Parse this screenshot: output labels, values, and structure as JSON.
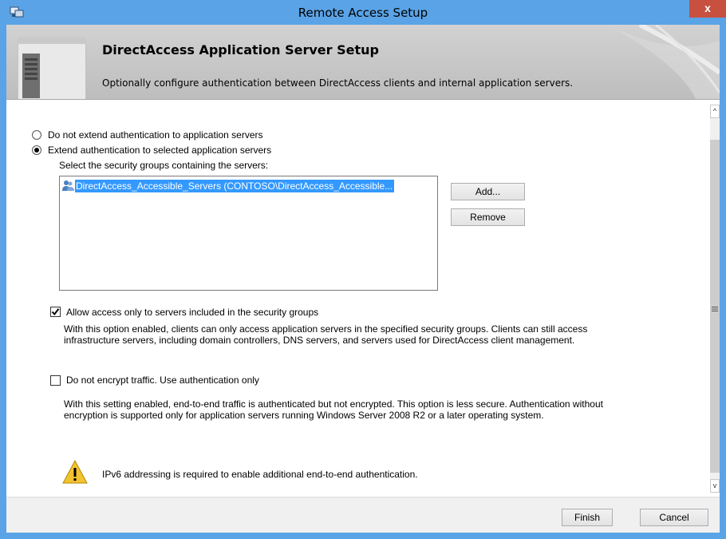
{
  "window": {
    "title": "Remote Access Setup",
    "close_glyph": "x"
  },
  "header": {
    "title": "DirectAccess Application Server Setup",
    "subtitle": "Optionally configure authentication between DirectAccess clients and internal application servers.",
    "icon": "server-icon"
  },
  "options": {
    "radio_no_extend": "Do not extend authentication to application servers",
    "radio_extend": "Extend authentication to selected application servers",
    "selected_radio": "extend"
  },
  "groups": {
    "label": "Select the security groups containing the servers:",
    "items": [
      {
        "text": "DirectAccess_Accessible_Servers (CONTOSO\\DirectAccess_Accessible...",
        "selected": true,
        "icon": "group-icon"
      }
    ],
    "add_label": "Add...",
    "remove_label": "Remove"
  },
  "allow_access": {
    "checked": true,
    "label": "Allow access only to servers included in the security groups",
    "desc_line1": "With this option enabled, clients can only access application servers in the specified security groups. Clients can still access",
    "desc_line2": "infrastructure servers, including domain controllers, DNS servers, and servers used for DirectAccess client management."
  },
  "no_encrypt": {
    "checked": false,
    "label": "Do not encrypt traffic. Use authentication only",
    "desc_line1": "With this setting enabled, end-to-end traffic is authenticated but not encrypted. This option is less secure. Authentication without",
    "desc_line2": "encryption is supported only for application servers running Windows Server 2008 R2 or a later operating system."
  },
  "warning": {
    "icon": "warning-icon",
    "text": "IPv6 addressing is required to enable additional end-to-end authentication."
  },
  "footer": {
    "finish_label": "Finish",
    "cancel_label": "Cancel"
  },
  "colors": {
    "titlebar": "#5aa3e6",
    "close": "#c7503f",
    "selection": "#3399ff"
  }
}
